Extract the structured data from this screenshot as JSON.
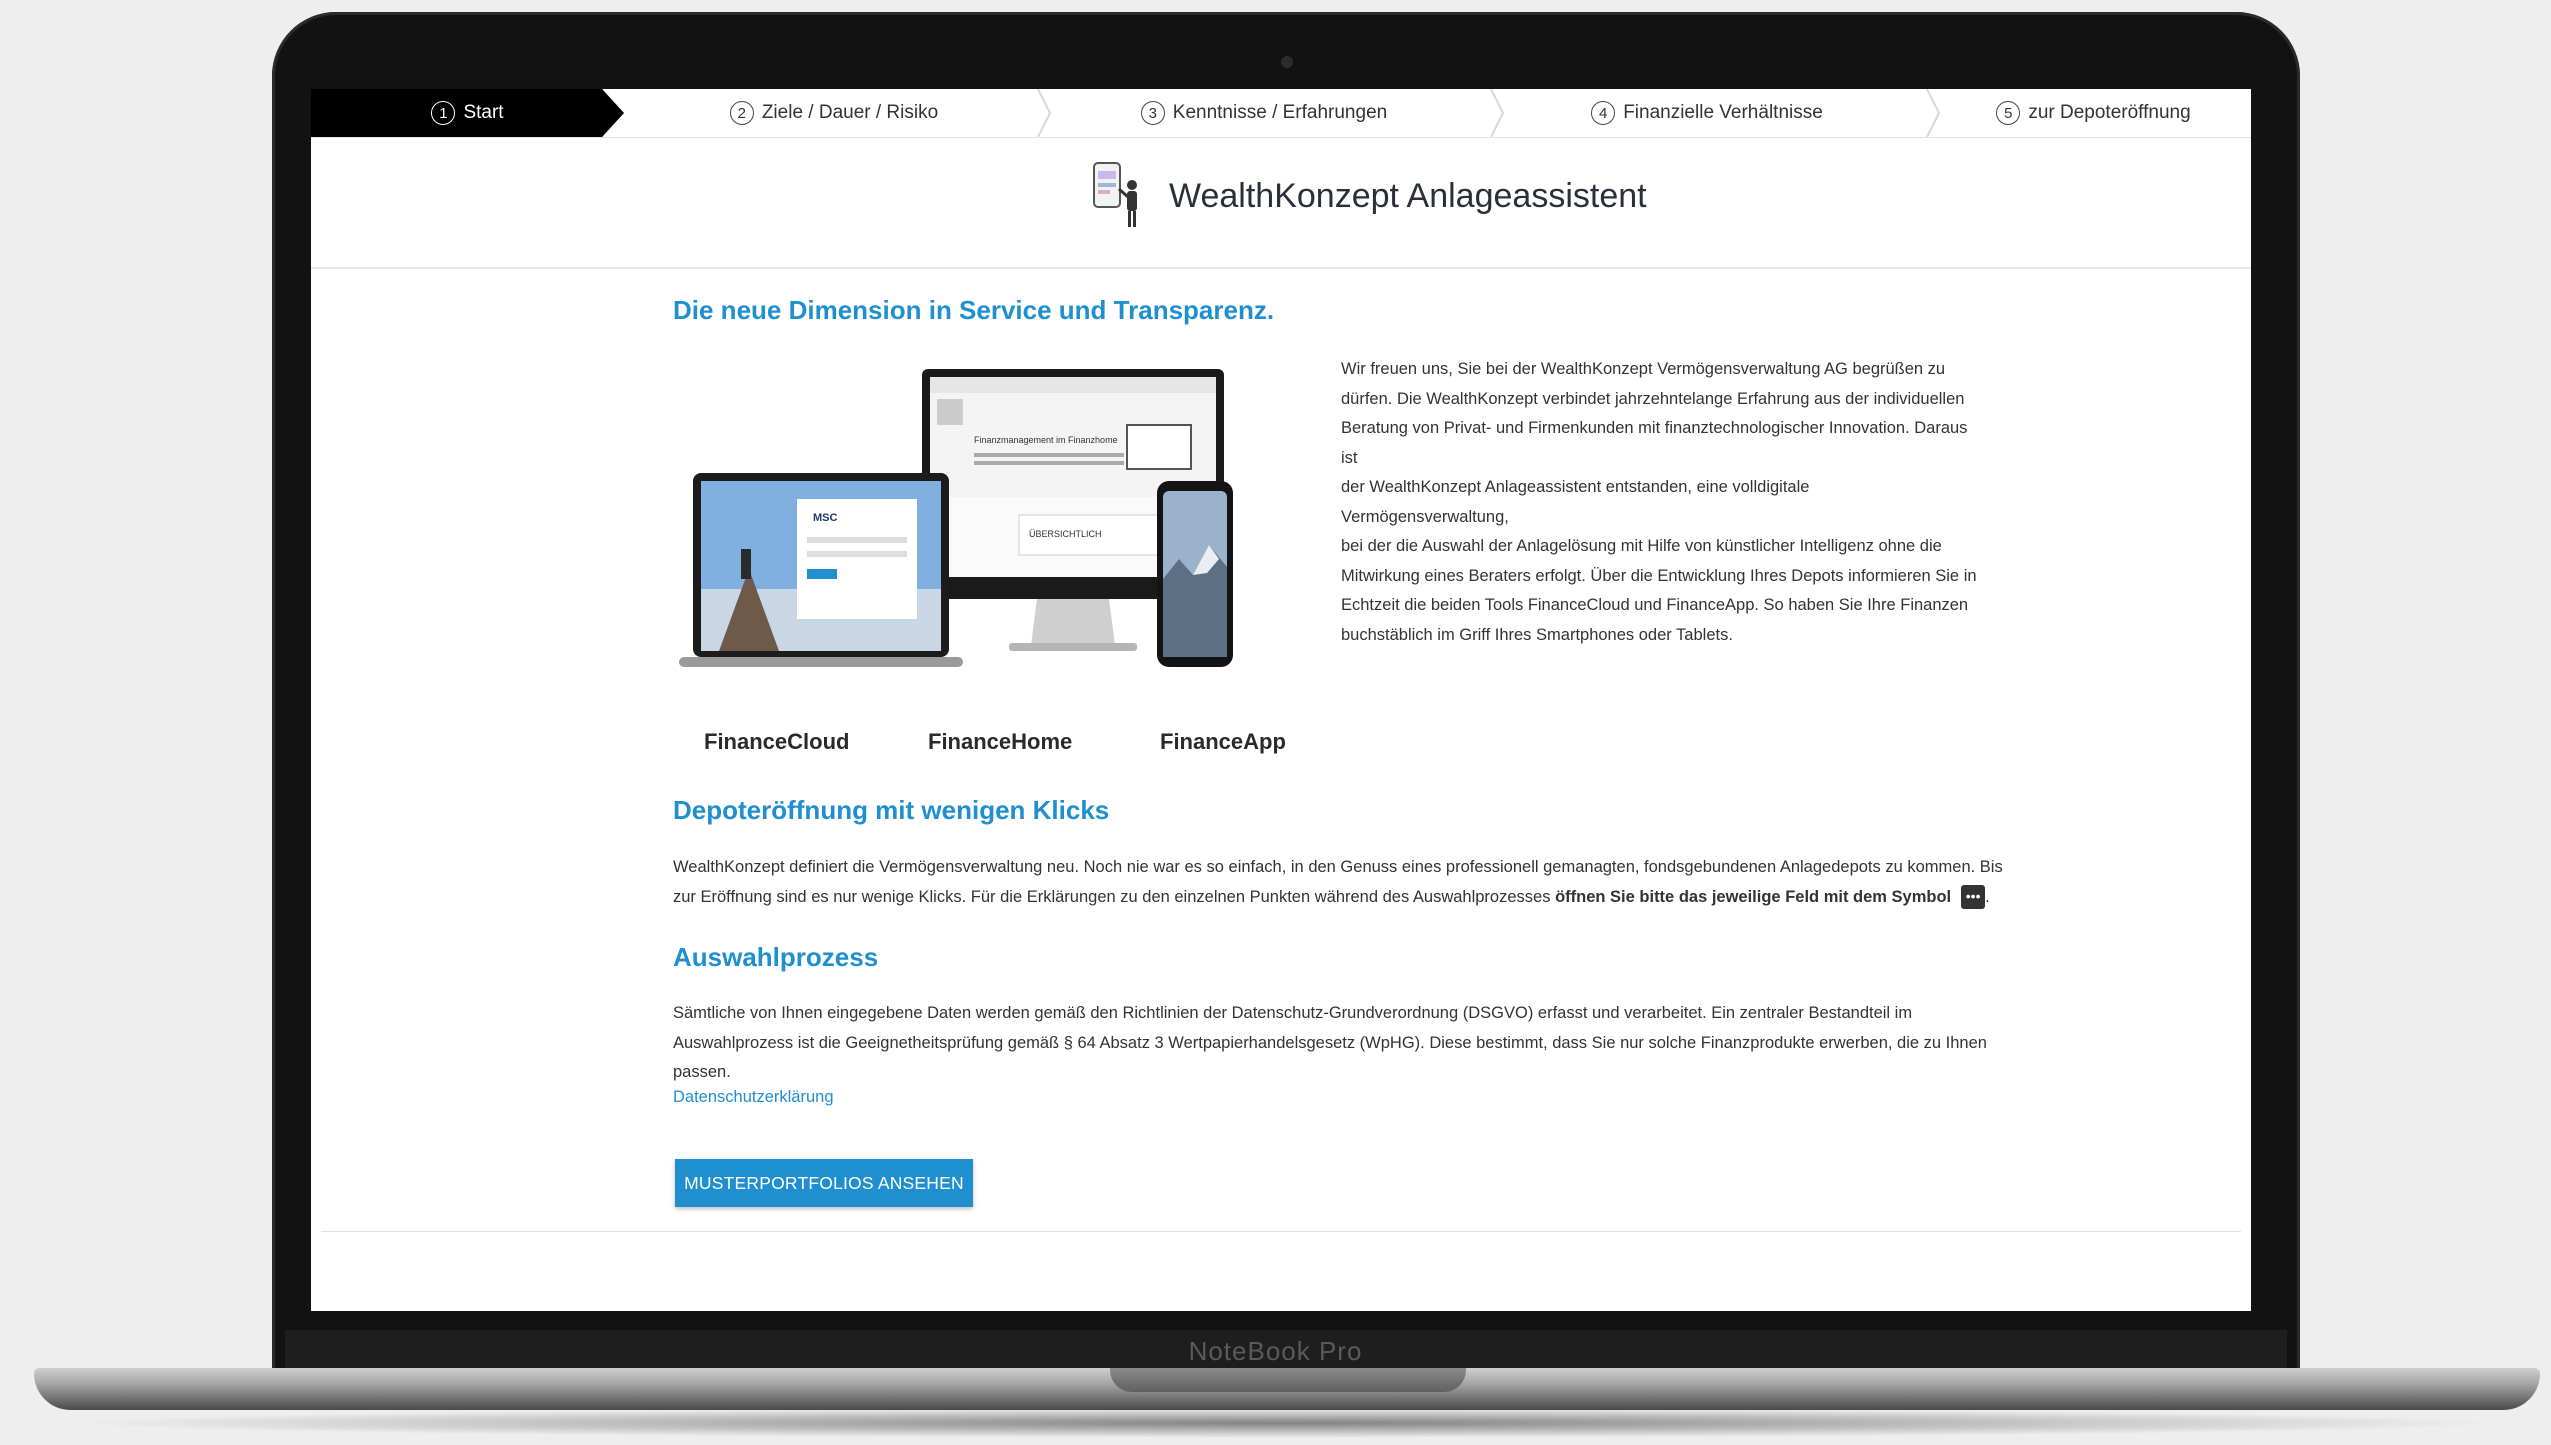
{
  "device_label": "NoteBook Pro",
  "steps": [
    {
      "num": "1",
      "label": "Start"
    },
    {
      "num": "2",
      "label": "Ziele / Dauer / Risiko"
    },
    {
      "num": "3",
      "label": "Kenntnisse / Erfahrungen"
    },
    {
      "num": "4",
      "label": "Finanzielle Verhältnisse"
    },
    {
      "num": "5",
      "label": "zur Depoteröffnung"
    }
  ],
  "header": {
    "title": "WealthKonzept Anlageassistent"
  },
  "intro": {
    "heading": "Die neue Dimension in Service und Transparenz.",
    "lines": [
      "Wir freuen uns, Sie bei der WealthKonzept Vermögensverwaltung AG begrüßen zu",
      "dürfen. Die WealthKonzept verbindet jahrzehntelange Erfahrung aus der individuellen",
      "Beratung von Privat- und Firmenkunden mit finanztechnologischer Innovation. Daraus ist",
      "der WealthKonzept Anlageassistent entstanden, eine volldigitale Vermögensverwaltung,",
      "bei der die Auswahl der Anlagelösung mit Hilfe von künstlicher Intelligenz ohne die",
      "Mitwirkung eines Beraters erfolgt. Über die Entwicklung Ihres Depots informieren Sie in",
      "Echtzeit die beiden Tools FinanceCloud und FinanceApp. So haben Sie Ihre Finanzen",
      "buchstäblich im Griff Ihres Smartphones oder Tablets."
    ]
  },
  "products": [
    "FinanceCloud",
    "FinanceHome",
    "FinanceApp"
  ],
  "screens": {
    "laptop_logo": "MSC",
    "monitor_heading": "Finanzmanagement im Finanzhome",
    "monitor_panel": "ÜBERSICHTLICH"
  },
  "depot": {
    "heading": "Depoteröffnung mit wenigen Klicks",
    "line1": "WealthKonzept definiert die Vermögensverwaltung neu. Noch nie war es so einfach, in den Genuss eines professionell gemanagten, fondsgebundenen Anlagedepots zu kommen. Bis",
    "line2": "zur Eröffnung sind es nur wenige Klicks. Für die Erklärungen zu den einzelnen Punkten während des Auswahlprozesses",
    "line2_bold": "öffnen Sie bitte das jeweilige Feld mit dem Symbol",
    "symbol": "•••",
    "line2_end": "."
  },
  "auswahl": {
    "heading": "Auswahlprozess",
    "lines": [
      "Sämtliche von Ihnen eingegebene Daten werden gemäß den Richtlinien der Datenschutz-Grundverordnung (DSGVO) erfasst und verarbeitet. Ein zentraler Bestandteil im",
      "Auswahlprozess ist die Geeignetheitsprüfung gemäß § 64 Absatz 3 Wertpapierhandelsgesetz (WpHG). Diese bestimmt, dass Sie nur solche Finanzprodukte erwerben, die zu Ihnen",
      "passen."
    ],
    "link": "Datenschutzerklärung"
  },
  "button": {
    "label": "MUSTERPORTFOLIOS ANSEHEN"
  },
  "colors": {
    "accent": "#1f8fcf",
    "active_step": "#000000"
  }
}
